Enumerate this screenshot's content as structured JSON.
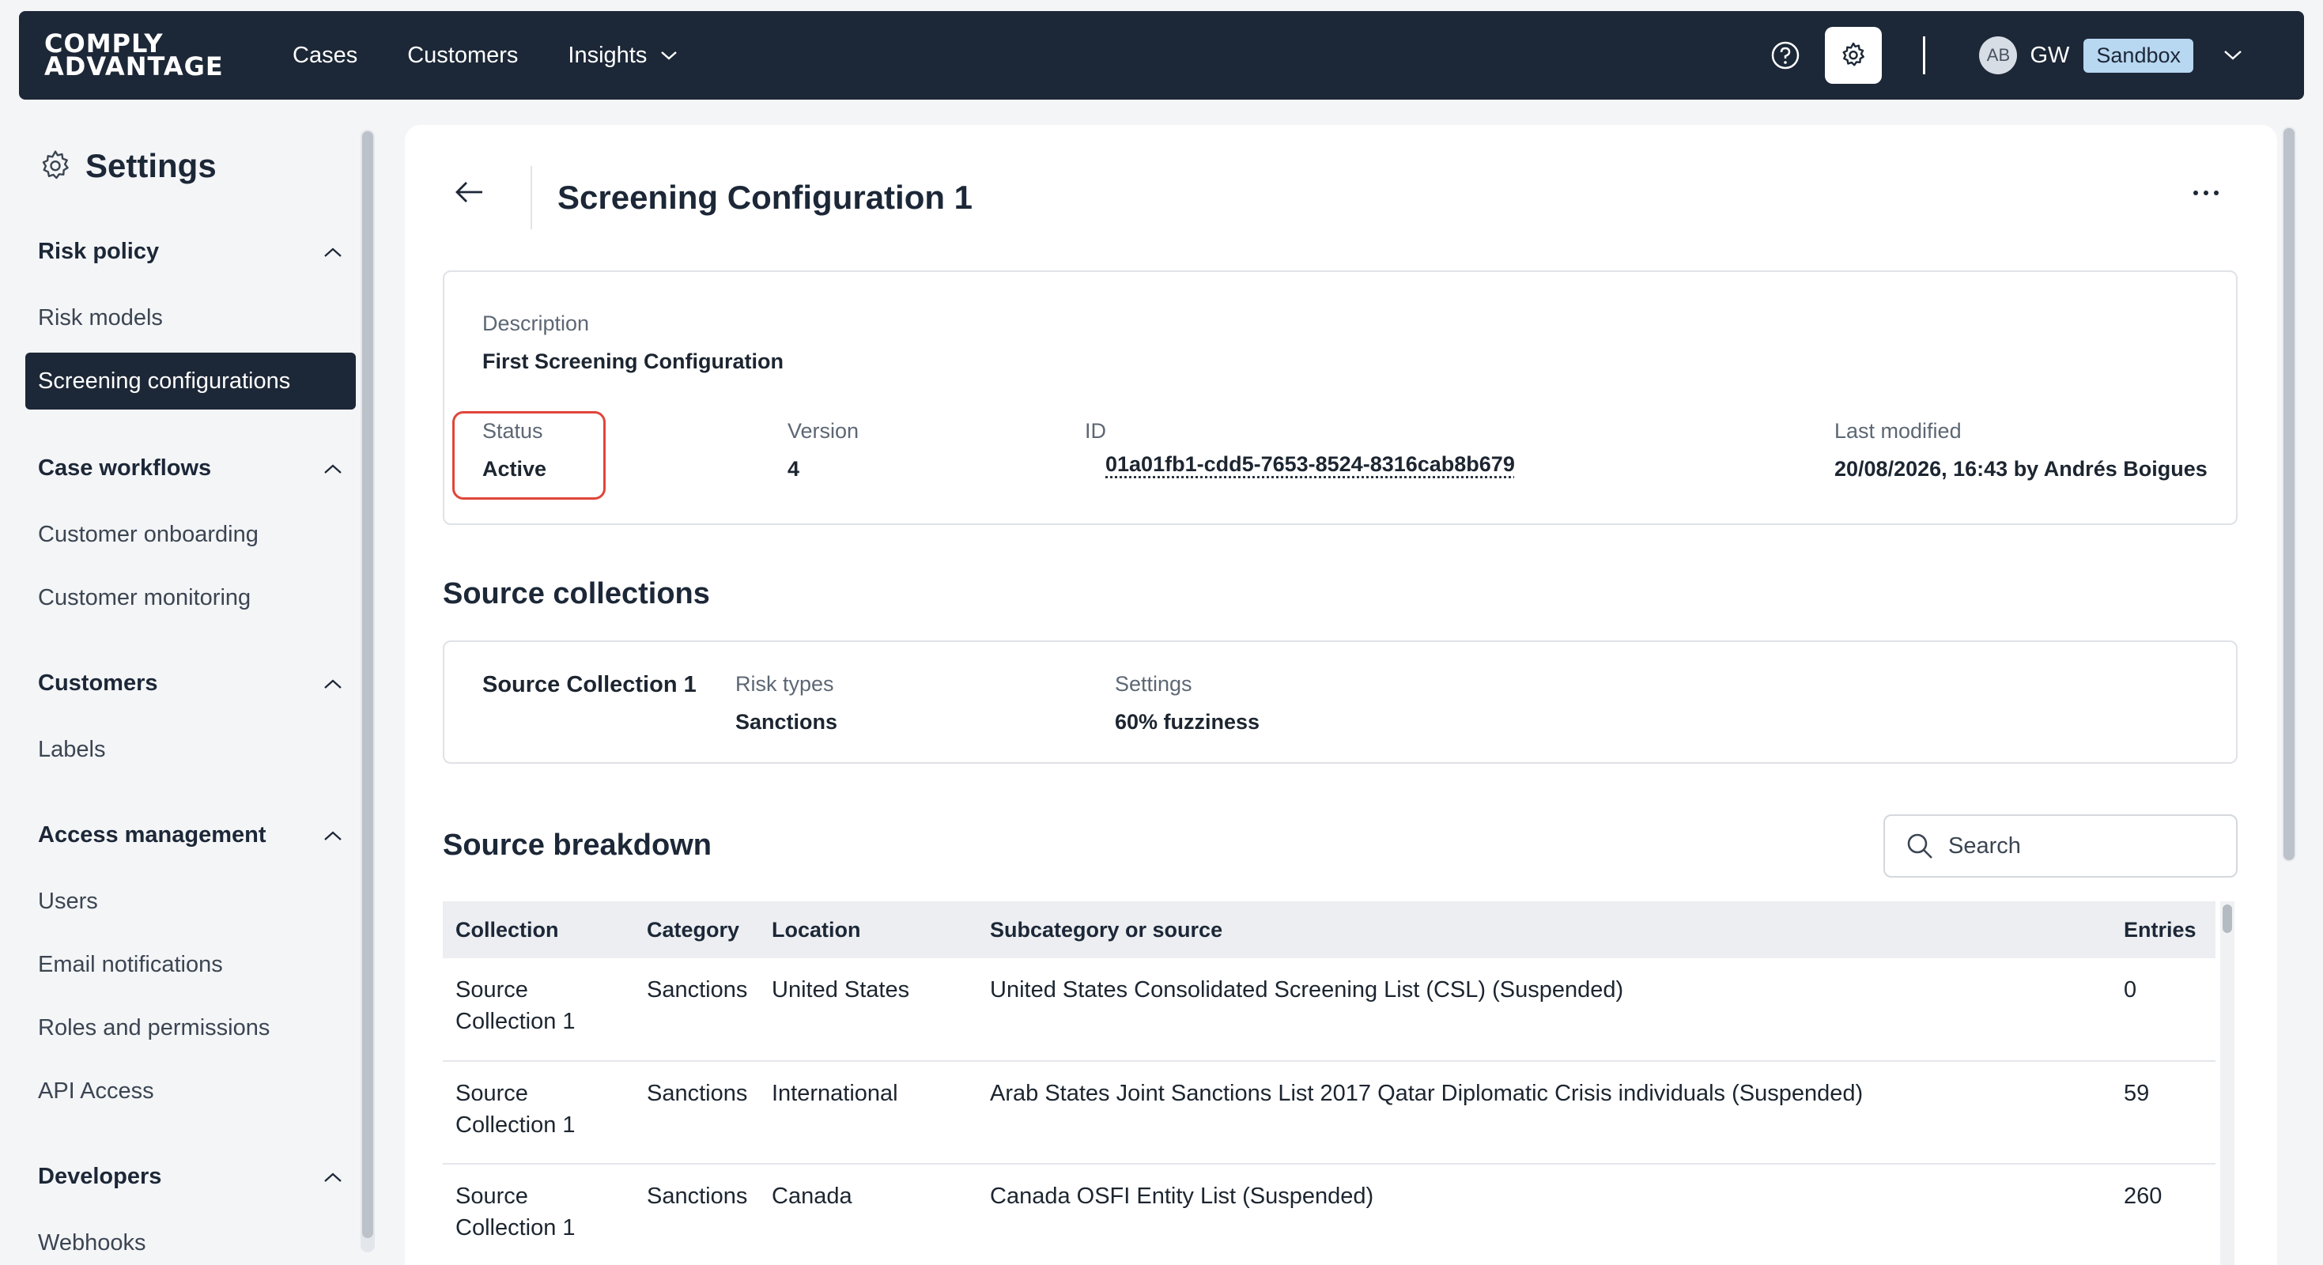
{
  "topbar": {
    "logo_line1": "COMPLY",
    "logo_line2": "ADVANTAGE",
    "nav": [
      "Cases",
      "Customers",
      "Insights"
    ],
    "avatar_initials": "AB",
    "user_initials": "GW",
    "environment": "Sandbox"
  },
  "sidebar": {
    "title": "Settings",
    "groups": [
      {
        "label": "Risk policy",
        "items": [
          "Risk models",
          "Screening configurations"
        ]
      },
      {
        "label": "Case workflows",
        "items": [
          "Customer onboarding",
          "Customer monitoring"
        ]
      },
      {
        "label": "Customers",
        "items": [
          "Labels"
        ]
      },
      {
        "label": "Access management",
        "items": [
          "Users",
          "Email notifications",
          "Roles and permissions",
          "API Access"
        ]
      },
      {
        "label": "Developers",
        "items": [
          "Webhooks"
        ]
      }
    ],
    "active_item": "Screening configurations"
  },
  "page": {
    "title": "Screening Configuration 1",
    "description_label": "Description",
    "description_value": "First Screening Configuration",
    "status_label": "Status",
    "status_value": "Active",
    "version_label": "Version",
    "version_value": "4",
    "id_label": "ID",
    "id_value": "01a01fb1-cdd5-7653-8524-8316cab8b679",
    "modified_label": "Last modified",
    "modified_value": "20/08/2026, 16:43 by Andrés Boigues"
  },
  "source_collections": {
    "title": "Source collections",
    "name": "Source Collection 1",
    "risk_types_label": "Risk types",
    "risk_types_value": "Sanctions",
    "settings_label": "Settings",
    "settings_value": "60% fuzziness"
  },
  "source_breakdown": {
    "title": "Source breakdown",
    "search_placeholder": "Search",
    "columns": [
      "Collection",
      "Category",
      "Location",
      "Subcategory or source",
      "Entries"
    ],
    "rows": [
      [
        "Source Collection 1",
        "Sanctions",
        "United States",
        "United States Consolidated Screening List (CSL) (Suspended)",
        "0"
      ],
      [
        "Source Collection 1",
        "Sanctions",
        "International",
        "Arab States Joint Sanctions List 2017 Qatar Diplomatic Crisis individuals (Suspended)",
        "59"
      ],
      [
        "Source Collection 1",
        "Sanctions",
        "Canada",
        "Canada OSFI Entity List (Suspended)",
        "260"
      ]
    ]
  },
  "colors": {
    "nav_bg": "#1c2737",
    "env_badge": "#b8d7f0",
    "highlight_border": "#e0463b"
  }
}
